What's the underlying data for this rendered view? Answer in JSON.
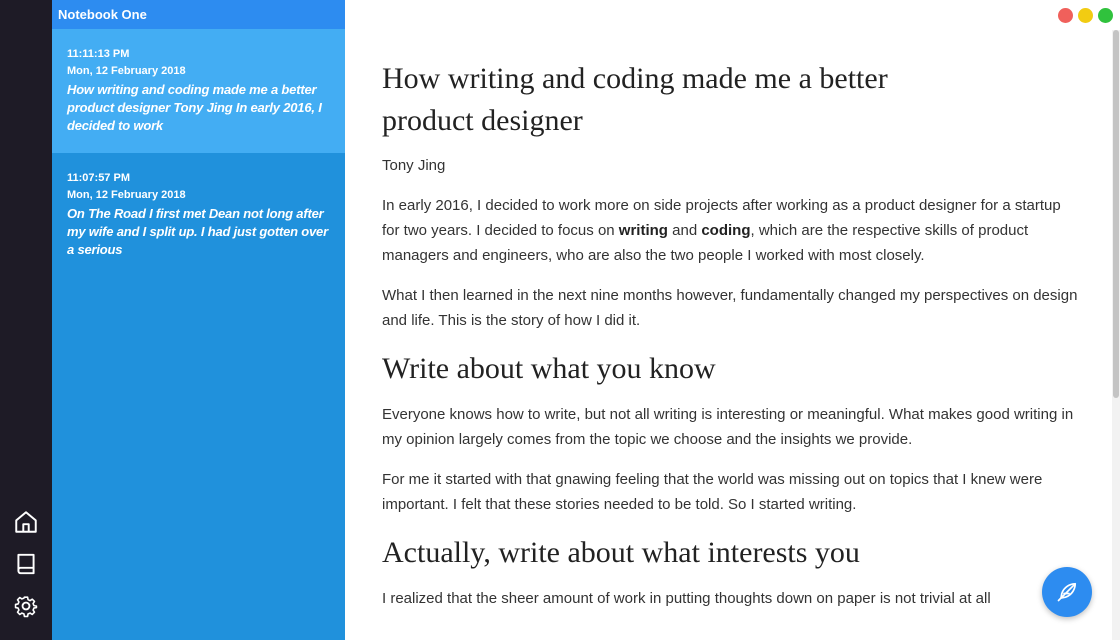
{
  "sidebar": {
    "notebook_title": "Notebook One",
    "notes": [
      {
        "time": "11:11:13 PM",
        "date": "Mon, 12 February 2018",
        "preview": "How writing and coding made me a better product designer Tony Jing In early 2016, I decided to work"
      },
      {
        "time": "11:07:57 PM",
        "date": "Mon, 12 February 2018",
        "preview": "On The Road I first met Dean not long after my wife and I split up. I had just gotten over a serious"
      }
    ]
  },
  "rail": {
    "icons": [
      "home-icon",
      "book-icon",
      "gear-icon"
    ]
  },
  "document": {
    "title": "How writing and coding made me a better product designer",
    "author": "Tony Jing",
    "p1_a": "In early 2016, I decided to work more on side projects after working as a product designer for a startup for two years. I decided to focus on ",
    "p1_b1": "writing",
    "p1_c": " and ",
    "p1_b2": "coding",
    "p1_d": ", which are the respective skills of product managers and engineers, who are also the two people I worked with most closely.",
    "p2": "What I then learned in the next nine months however, fundamentally changed my perspectives on design and life. This is the story of how I did it.",
    "h2_1": "Write about what you know",
    "p3": "Everyone knows how to write, but not all writing is interesting or meaningful. What makes good writing in my opinion largely comes from the topic we choose and the insights we provide.",
    "p4": "For me it started with that gnawing feeling that the world was missing out on topics that I knew were important. I felt that these stories needed to be told. So I started writing.",
    "h2_2": "Actually, write about what interests you",
    "p5": "I realized that the sheer amount of work in putting thoughts down on paper is not trivial at all"
  },
  "fab": {
    "icon": "feather-pen-icon"
  },
  "colors": {
    "rail_bg": "#1e1b26",
    "list_bg": "#2091dc",
    "header_bg": "#2d8cf0",
    "active_note_bg": "#43adf3",
    "accent": "#2d8cf0"
  }
}
